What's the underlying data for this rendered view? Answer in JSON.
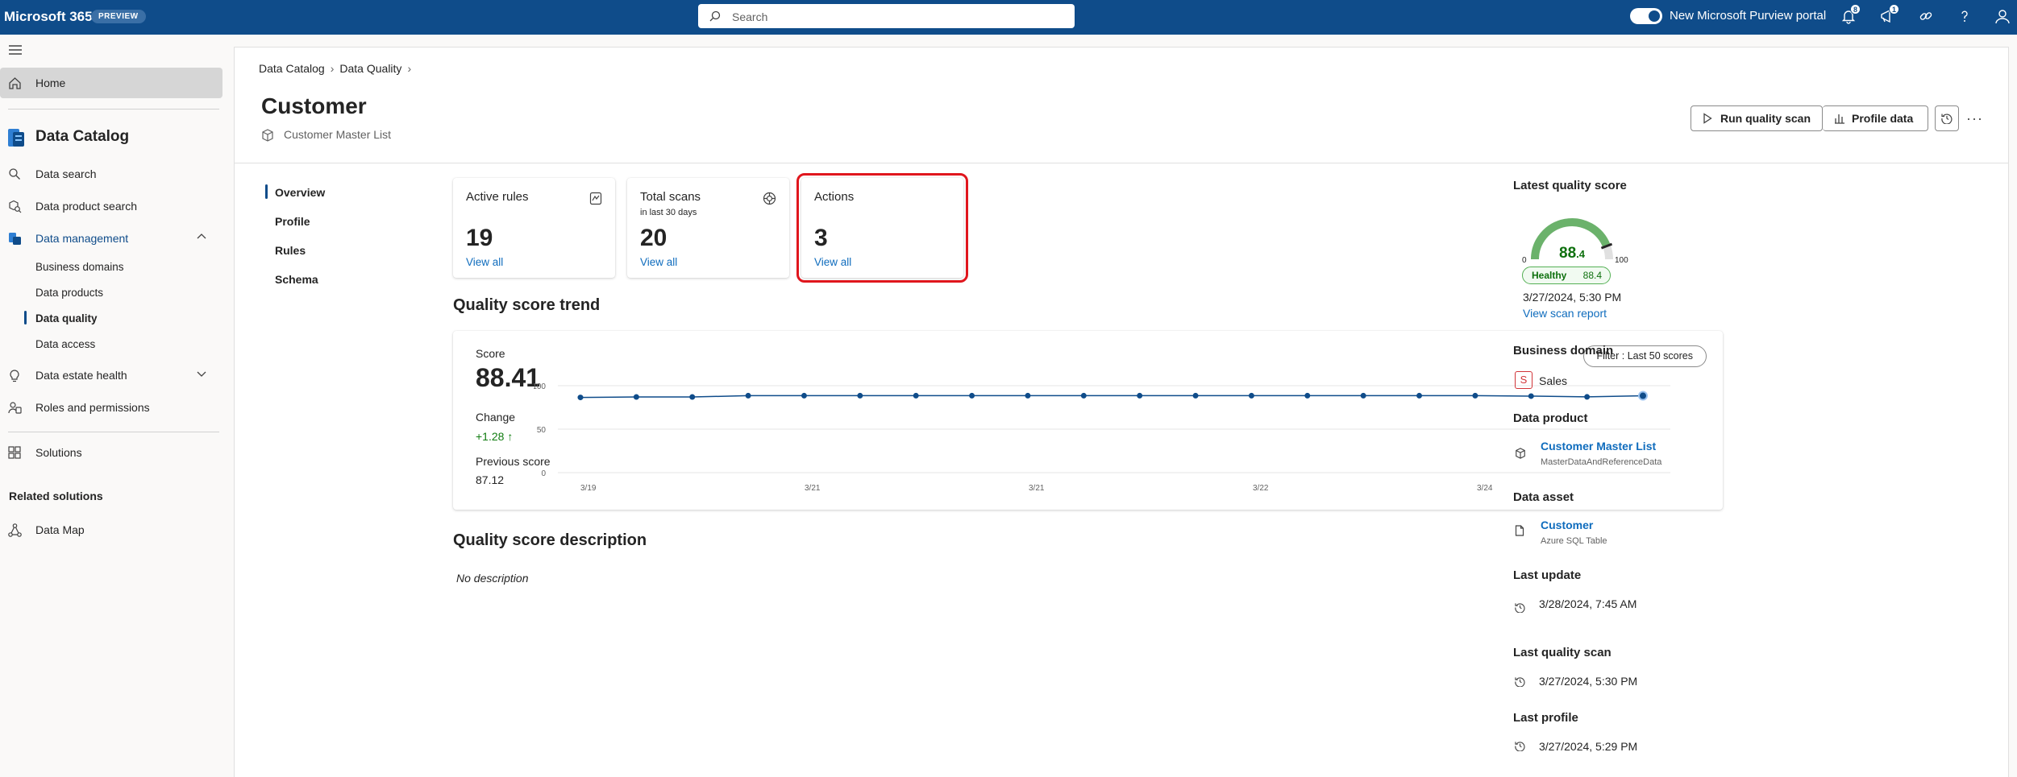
{
  "topbar": {
    "brand": "Microsoft 365",
    "preview_badge": "PREVIEW",
    "search_placeholder": "Search",
    "portal_toggle_label": "New Microsoft Purview portal",
    "notifications_count": "8",
    "alerts_count": "1",
    "accent_color": "#0f4c8a"
  },
  "leftnav": {
    "home": "Home",
    "app_title": "Data Catalog",
    "items": [
      "Data search",
      "Data product search",
      "Data management"
    ],
    "sub_items": [
      "Business domains",
      "Data products",
      "Data quality",
      "Data access"
    ],
    "more_items": [
      "Data estate health",
      "Roles and permissions",
      "Solutions"
    ],
    "related_header": "Related solutions",
    "related_items": [
      "Data Map"
    ]
  },
  "page": {
    "breadcrumb": [
      "Data Catalog",
      "Data Quality"
    ],
    "title": "Customer",
    "subtitle": "Customer Master List",
    "run_scan": "Run quality scan",
    "profile_data": "Profile data",
    "more": "···"
  },
  "subnav": [
    "Overview",
    "Profile",
    "Rules",
    "Schema"
  ],
  "cards": [
    {
      "title": "Active rules",
      "subtitle": "",
      "value": "19",
      "link": "View all",
      "icon": "rules-icon"
    },
    {
      "title": "Total scans",
      "subtitle": "in last 30 days",
      "value": "20",
      "link": "View all",
      "icon": "scan-icon"
    },
    {
      "title": "Actions",
      "subtitle": "",
      "value": "3",
      "link": "View all",
      "icon": ""
    }
  ],
  "trend": {
    "title": "Quality score trend",
    "score_label": "Score",
    "score": "88.41",
    "change_label": "Change",
    "change": "+1.28 ↑",
    "prev_label": "Previous score",
    "prev": "87.12",
    "filter": "Filter : Last 50 scores"
  },
  "chart_data": {
    "type": "line",
    "title": "",
    "xlabel": "",
    "ylabel": "",
    "ylim": [
      0,
      100
    ],
    "y_ticks": [
      100,
      50,
      0
    ],
    "x_tick_labels": [
      "3/19",
      "3/21",
      "3/21",
      "3/22",
      "3/24"
    ],
    "series": [
      {
        "values": [
          86.5,
          87,
          87,
          88.5,
          88.5,
          88.5,
          88.5,
          88.5,
          88.5,
          88.5,
          88.5,
          88.5,
          88.5,
          88.5,
          88.5,
          88.5,
          88.5,
          88,
          87.1,
          88.41
        ],
        "color": "#0f4c8a"
      }
    ],
    "grid": true
  },
  "description": {
    "title": "Quality score description",
    "text": "No description"
  },
  "rightpanel": {
    "latest_header": "Latest quality score",
    "gauge_value": "88",
    "gauge_decimal": ".4",
    "gauge_min": "0",
    "gauge_max": "100",
    "gauge_fraction": 0.884,
    "healthy": "Healthy",
    "healthy_value": "88.4",
    "score_date": "3/27/2024, 5:30 PM",
    "scan_report": "View scan report",
    "bd_header": "Business domain",
    "bd_badge": "S",
    "bd_name": "Sales",
    "dp_header": "Data product",
    "dp_name": "Customer Master List",
    "dp_sub": "MasterDataAndReferenceData",
    "da_header": "Data asset",
    "da_name": "Customer",
    "da_sub": "Azure SQL Table",
    "lu_header": "Last update",
    "lu_date": "3/28/2024, 7:45 AM",
    "lqs_header": "Last quality scan",
    "lqs_date": "3/27/2024, 5:30 PM",
    "lp_header": "Last profile",
    "lp_date": "3/27/2024, 5:29 PM"
  }
}
